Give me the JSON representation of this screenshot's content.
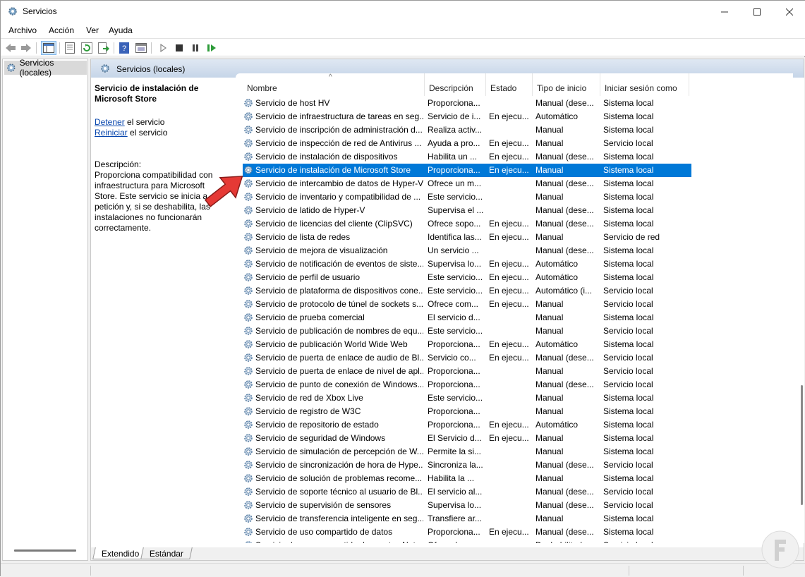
{
  "window": {
    "title": "Servicios"
  },
  "menu": [
    "Archivo",
    "Acción",
    "Ver",
    "Ayuda"
  ],
  "tree": {
    "root_label": "Servicios (locales)"
  },
  "pane_header": "Servicios (locales)",
  "details": {
    "title": "Servicio de instalación de Microsoft Store",
    "stop_link": "Detener",
    "stop_suffix": " el servicio",
    "restart_link": "Reiniciar",
    "restart_suffix": " el servicio",
    "desc_label": "Descripción:",
    "desc_text": "Proporciona compatibilidad con infraestructura para Microsoft Store. Este servicio se inicia a petición y, si se deshabilita, las instalaciones no funcionarán correctamente."
  },
  "columns": [
    "Nombre",
    "Descripción",
    "Estado",
    "Tipo de inicio",
    "Iniciar sesión como"
  ],
  "services": [
    {
      "name": "Servicio de host HV",
      "desc": "Proporciona...",
      "status": "",
      "start": "Manual (dese...",
      "logon": "Sistema local"
    },
    {
      "name": "Servicio de infraestructura de tareas en seg...",
      "desc": "Servicio de i...",
      "status": "En ejecu...",
      "start": "Automático",
      "logon": "Sistema local"
    },
    {
      "name": "Servicio de inscripción de administración d...",
      "desc": "Realiza activ...",
      "status": "",
      "start": "Manual",
      "logon": "Sistema local"
    },
    {
      "name": "Servicio de inspección de red de Antivirus ...",
      "desc": "Ayuda a pro...",
      "status": "En ejecu...",
      "start": "Manual",
      "logon": "Servicio local"
    },
    {
      "name": "Servicio de instalación de dispositivos",
      "desc": "Habilita un ...",
      "status": "En ejecu...",
      "start": "Manual (dese...",
      "logon": "Sistema local"
    },
    {
      "name": "Servicio de instalación de Microsoft Store",
      "desc": "Proporciona...",
      "status": "En ejecu...",
      "start": "Manual",
      "logon": "Sistema local",
      "selected": true
    },
    {
      "name": "Servicio de intercambio de datos de Hyper-V",
      "desc": "Ofrece un m...",
      "status": "",
      "start": "Manual (dese...",
      "logon": "Sistema local"
    },
    {
      "name": "Servicio de inventario y compatibilidad de ...",
      "desc": "Este servicio...",
      "status": "",
      "start": "Manual",
      "logon": "Sistema local"
    },
    {
      "name": "Servicio de latido de Hyper-V",
      "desc": "Supervisa el ...",
      "status": "",
      "start": "Manual (dese...",
      "logon": "Sistema local"
    },
    {
      "name": "Servicio de licencias del cliente (ClipSVC)",
      "desc": "Ofrece sopo...",
      "status": "En ejecu...",
      "start": "Manual (dese...",
      "logon": "Sistema local"
    },
    {
      "name": "Servicio de lista de redes",
      "desc": "Identifica las...",
      "status": "En ejecu...",
      "start": "Manual",
      "logon": "Servicio de red"
    },
    {
      "name": "Servicio de mejora de visualización",
      "desc": "Un servicio ...",
      "status": "",
      "start": "Manual (dese...",
      "logon": "Sistema local"
    },
    {
      "name": "Servicio de notificación de eventos de siste...",
      "desc": "Supervisa lo...",
      "status": "En ejecu...",
      "start": "Automático",
      "logon": "Sistema local"
    },
    {
      "name": "Servicio de perfil de usuario",
      "desc": "Este servicio...",
      "status": "En ejecu...",
      "start": "Automático",
      "logon": "Sistema local"
    },
    {
      "name": "Servicio de plataforma de dispositivos cone...",
      "desc": "Este servicio...",
      "status": "En ejecu...",
      "start": "Automático (i...",
      "logon": "Servicio local"
    },
    {
      "name": "Servicio de protocolo de túnel de sockets s...",
      "desc": "Ofrece com...",
      "status": "En ejecu...",
      "start": "Manual",
      "logon": "Servicio local"
    },
    {
      "name": "Servicio de prueba comercial",
      "desc": "El servicio d...",
      "status": "",
      "start": "Manual",
      "logon": "Sistema local"
    },
    {
      "name": "Servicio de publicación de nombres de equ...",
      "desc": "Este servicio...",
      "status": "",
      "start": "Manual",
      "logon": "Servicio local"
    },
    {
      "name": "Servicio de publicación World Wide Web",
      "desc": "Proporciona...",
      "status": "En ejecu...",
      "start": "Automático",
      "logon": "Sistema local"
    },
    {
      "name": "Servicio de puerta de enlace de audio de Bl...",
      "desc": "Servicio co...",
      "status": "En ejecu...",
      "start": "Manual (dese...",
      "logon": "Servicio local"
    },
    {
      "name": "Servicio de puerta de enlace de nivel de apl...",
      "desc": "Proporciona...",
      "status": "",
      "start": "Manual",
      "logon": "Servicio local"
    },
    {
      "name": "Servicio de punto de conexión de Windows...",
      "desc": "Proporciona...",
      "status": "",
      "start": "Manual (dese...",
      "logon": "Servicio local"
    },
    {
      "name": "Servicio de red de Xbox Live",
      "desc": "Este servicio...",
      "status": "",
      "start": "Manual",
      "logon": "Sistema local"
    },
    {
      "name": "Servicio de registro de W3C",
      "desc": "Proporciona...",
      "status": "",
      "start": "Manual",
      "logon": "Sistema local"
    },
    {
      "name": "Servicio de repositorio de estado",
      "desc": "Proporciona...",
      "status": "En ejecu...",
      "start": "Automático",
      "logon": "Sistema local"
    },
    {
      "name": "Servicio de seguridad de Windows",
      "desc": "El Servicio d...",
      "status": "En ejecu...",
      "start": "Manual",
      "logon": "Sistema local"
    },
    {
      "name": "Servicio de simulación de percepción de W...",
      "desc": "Permite la si...",
      "status": "",
      "start": "Manual",
      "logon": "Sistema local"
    },
    {
      "name": "Servicio de sincronización de hora de Hype...",
      "desc": "Sincroniza la...",
      "status": "",
      "start": "Manual (dese...",
      "logon": "Servicio local"
    },
    {
      "name": "Servicio de solución de problemas recome...",
      "desc": "Habilita la ...",
      "status": "",
      "start": "Manual",
      "logon": "Sistema local"
    },
    {
      "name": "Servicio de soporte técnico al usuario de Bl...",
      "desc": "El servicio al...",
      "status": "",
      "start": "Manual (dese...",
      "logon": "Servicio local"
    },
    {
      "name": "Servicio de supervisión de sensores",
      "desc": "Supervisa lo...",
      "status": "",
      "start": "Manual (dese...",
      "logon": "Servicio local"
    },
    {
      "name": "Servicio de transferencia inteligente en seg...",
      "desc": "Transfiere ar...",
      "status": "",
      "start": "Manual",
      "logon": "Sistema local"
    },
    {
      "name": "Servicio de uso compartido de datos",
      "desc": "Proporciona...",
      "status": "En ejecu...",
      "start": "Manual (dese...",
      "logon": "Sistema local"
    },
    {
      "name": "Servicio de uso compartido de puertos Net...",
      "desc": "Ofrece la po...",
      "status": "",
      "start": "Deshabilitado",
      "logon": "Servicio local"
    }
  ],
  "tabs": [
    "Extendido",
    "Estándar"
  ],
  "colors": {
    "selection": "#0078d7",
    "link": "#0645ad",
    "header_band": "#c6d5e8",
    "arrow": "#e53935"
  },
  "icons": [
    "gear-icon",
    "back-icon",
    "forward-icon",
    "console-tree-icon",
    "properties-icon",
    "refresh-icon",
    "export-icon",
    "help-icon",
    "view-icon",
    "play-icon",
    "stop-icon",
    "pause-icon",
    "resume-icon"
  ]
}
